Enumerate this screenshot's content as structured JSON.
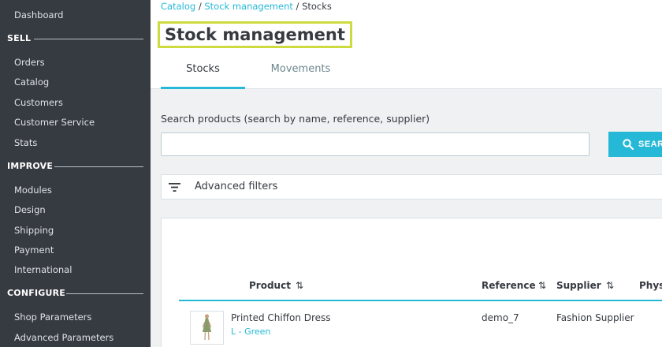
{
  "sidebar": {
    "dashboard": "Dashboard",
    "sections": [
      {
        "title": "SELL",
        "items": [
          "Orders",
          "Catalog",
          "Customers",
          "Customer Service",
          "Stats"
        ]
      },
      {
        "title": "IMPROVE",
        "items": [
          "Modules",
          "Design",
          "Shipping",
          "Payment",
          "International"
        ]
      },
      {
        "title": "CONFIGURE",
        "items": [
          "Shop Parameters",
          "Advanced Parameters"
        ]
      }
    ]
  },
  "breadcrumb": {
    "items": [
      "Catalog",
      "Stock management"
    ],
    "current": "Stocks",
    "separator": " / "
  },
  "page_title": "Stock management",
  "tabs": [
    {
      "label": "Stocks",
      "active": true
    },
    {
      "label": "Movements",
      "active": false
    }
  ],
  "search": {
    "label": "Search products (search by name, reference, supplier)",
    "value": "",
    "button_label": "SEARCH"
  },
  "filters": {
    "label": "Advanced filters"
  },
  "table": {
    "columns": [
      "Product",
      "Reference",
      "Supplier",
      "Physical"
    ],
    "rows": [
      {
        "product": "Printed Chiffon Dress",
        "variant": "L - Green",
        "reference": "demo_7",
        "supplier": "Fashion Supplier"
      }
    ]
  },
  "colors": {
    "accent": "#25b9d7",
    "sidebar_bg": "#363a41",
    "highlight": "#cddb3e"
  }
}
